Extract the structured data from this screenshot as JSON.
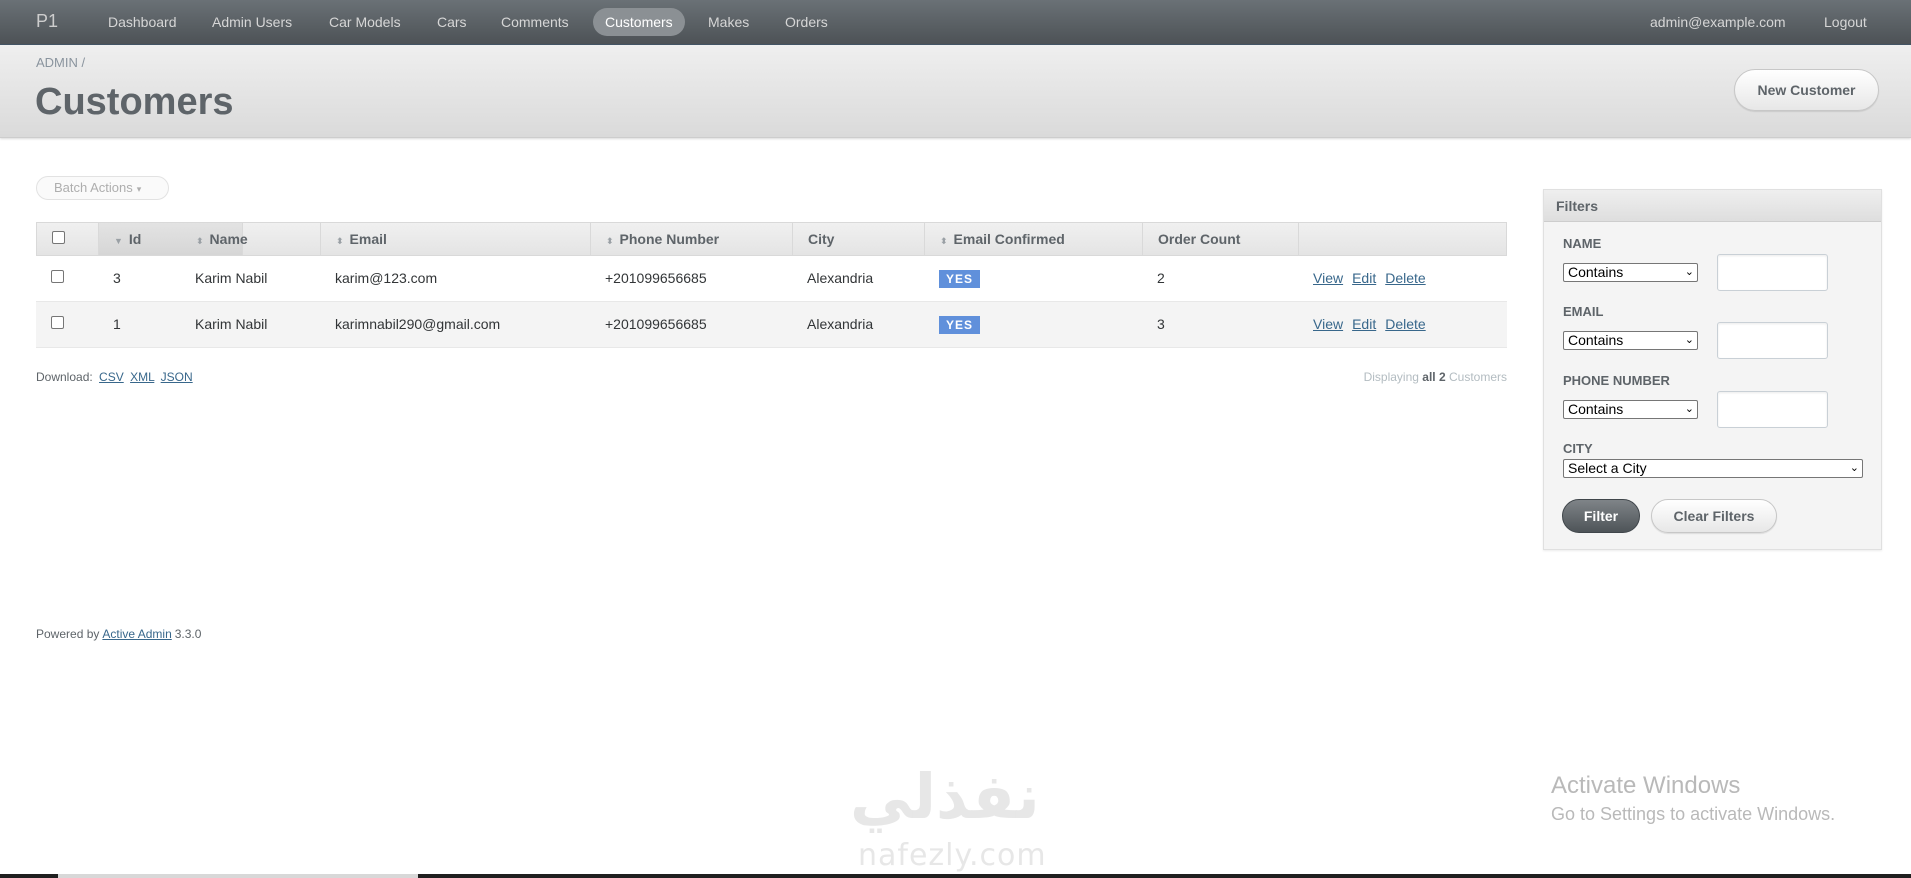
{
  "nav": {
    "brand": "P1",
    "items": [
      {
        "label": "Dashboard"
      },
      {
        "label": "Admin Users"
      },
      {
        "label": "Car Models"
      },
      {
        "label": "Cars"
      },
      {
        "label": "Comments"
      },
      {
        "label": "Customers",
        "active": true
      },
      {
        "label": "Makes"
      },
      {
        "label": "Orders"
      }
    ],
    "user_email": "admin@example.com",
    "logout": "Logout"
  },
  "breadcrumb": {
    "root": "ADMIN",
    "separator": "/"
  },
  "page_title": "Customers",
  "new_button": "New Customer",
  "batch_actions": {
    "label": "Batch Actions",
    "caret": "▾"
  },
  "table": {
    "columns": [
      "",
      "Id",
      "Name",
      "Email",
      "Phone Number",
      "City",
      "Email Confirmed",
      "Order Count",
      ""
    ],
    "sort_icons": {
      "sorted": "▼",
      "sortable": "⬍"
    },
    "rows": [
      {
        "id": "3",
        "name": "Karim Nabil",
        "email": "karim@123.com",
        "phone": "+201099656685",
        "city": "Alexandria",
        "email_confirmed": "YES",
        "order_count": "2",
        "actions": [
          "View",
          "Edit",
          "Delete"
        ]
      },
      {
        "id": "1",
        "name": "Karim Nabil",
        "email": "karimnabil290@gmail.com",
        "phone": "+201099656685",
        "city": "Alexandria",
        "email_confirmed": "YES",
        "order_count": "3",
        "actions": [
          "View",
          "Edit",
          "Delete"
        ]
      }
    ]
  },
  "download": {
    "label": "Download:",
    "formats": [
      "CSV",
      "XML",
      "JSON"
    ]
  },
  "pagination": {
    "prefix": "Displaying",
    "bold": "all 2",
    "suffix": "Customers"
  },
  "footer": {
    "prefix": "Powered by",
    "link": "Active Admin",
    "version": "3.3.0"
  },
  "filters": {
    "title": "Filters",
    "fields": [
      {
        "label": "NAME",
        "operator": "Contains",
        "value": ""
      },
      {
        "label": "EMAIL",
        "operator": "Contains",
        "value": ""
      },
      {
        "label": "PHONE NUMBER",
        "operator": "Contains",
        "value": ""
      }
    ],
    "city": {
      "label": "CITY",
      "selected": "Select a City"
    },
    "filter_button": "Filter",
    "clear_button": "Clear Filters"
  },
  "watermark": {
    "windows_title": "Activate Windows",
    "windows_sub": "Go to Settings to activate Windows.",
    "logo_ar": "نفذلي",
    "logo_en": "nafezly.com"
  },
  "colors": {
    "accent_badge": "#6090db",
    "link": "#38678b",
    "nav_bg": "#5e6469"
  }
}
